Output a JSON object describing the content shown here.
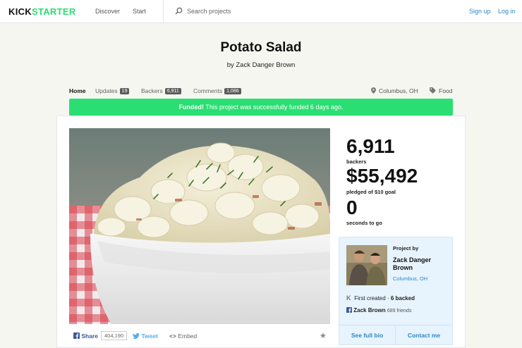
{
  "topbar": {
    "logo_left": "KICK",
    "logo_right": "STARTER",
    "discover": "Discover",
    "start": "Start",
    "search_placeholder": "Search projects",
    "sign_up": "Sign up",
    "log_in": "Log in"
  },
  "project": {
    "title": "Potato Salad",
    "byline": "by Zack Danger Brown"
  },
  "tabs": [
    {
      "label": "Home",
      "badge": ""
    },
    {
      "label": "Updates",
      "badge": "19"
    },
    {
      "label": "Backers",
      "badge": "6,911"
    },
    {
      "label": "Comments",
      "badge": "1,086"
    }
  ],
  "meta": {
    "location": "Columbus, OH",
    "category": "Food"
  },
  "funded": {
    "strong": "Funded!",
    "text": " This project was successfully funded 6 days ago."
  },
  "stats": {
    "backers_value": "6,911",
    "backers_label": "backers",
    "pledged_value": "$55,492",
    "pledged_label": "pledged of $10 goal",
    "time_value": "0",
    "time_label": "seconds to go"
  },
  "share": {
    "share_label": "Share",
    "share_count": "404,190",
    "tweet_label": "Tweet",
    "embed_label": "Embed"
  },
  "creator": {
    "heading": "Project by",
    "name_line1": "Zack Danger",
    "name_line2": "Brown",
    "location": "Columbus, OH",
    "first_created": "First created · ",
    "backed": "6 backed",
    "fb_name": "Zack Brown",
    "fb_friends": "689 friends",
    "see_bio": "See full bio",
    "contact": "Contact me"
  },
  "colors": {
    "brand_green": "#2bde73",
    "link_blue": "#2b88c8",
    "creator_box": "#e7f3fd"
  },
  "icons": [
    "search-icon",
    "location-pin-icon",
    "tag-icon",
    "facebook-icon",
    "twitter-icon",
    "embed-icon",
    "star-icon",
    "kickstarter-k-icon"
  ]
}
